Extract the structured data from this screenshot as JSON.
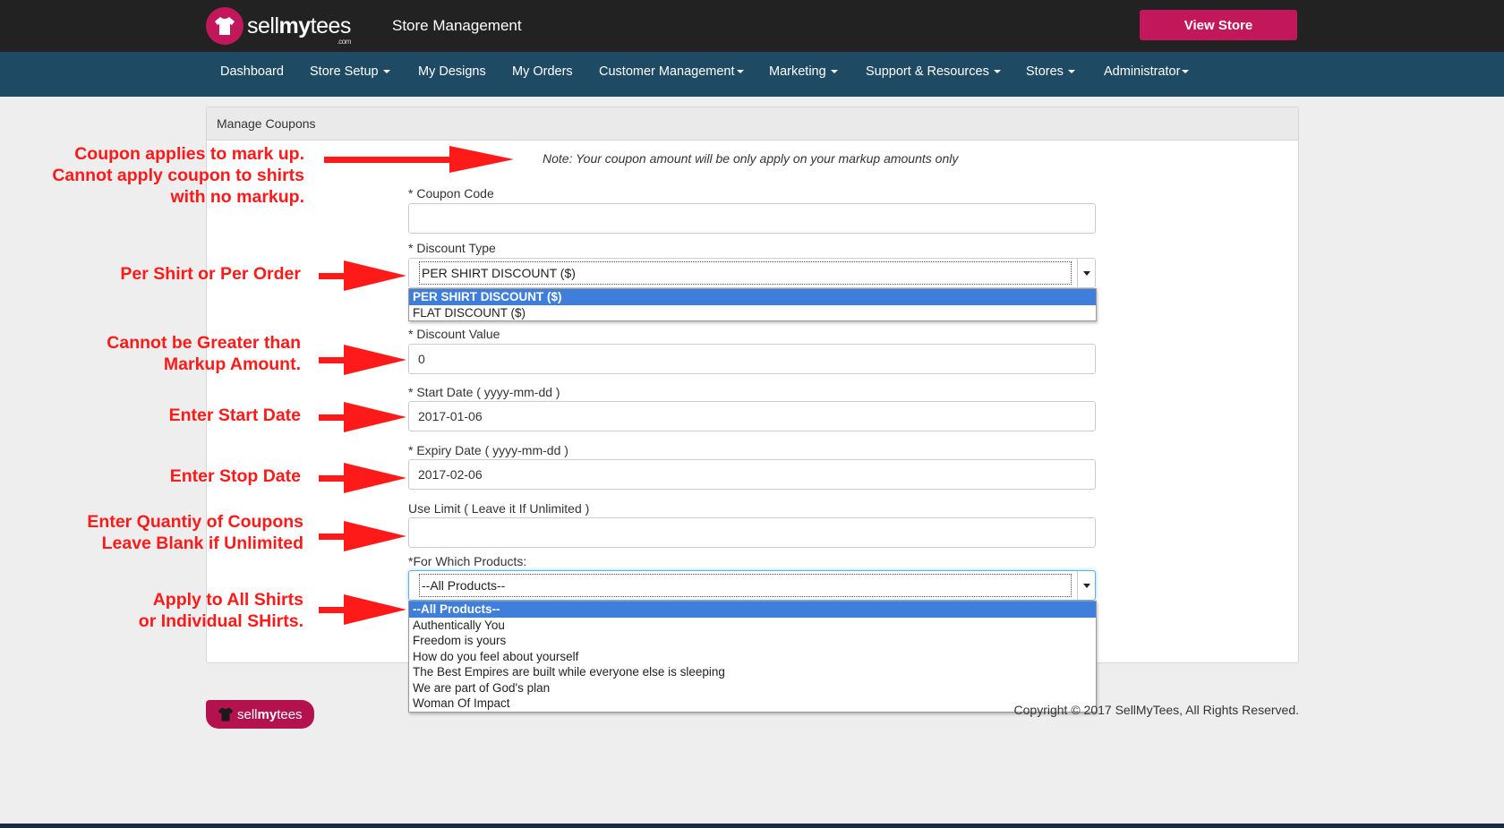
{
  "header": {
    "logo_sell": "sell",
    "logo_my": "my",
    "logo_tees": "tees",
    "logo_com": ".com",
    "title": "Store Management",
    "view_store_label": "View Store",
    "brand_color": "#c2185b"
  },
  "nav": {
    "items": [
      {
        "label": "Dashboard",
        "dropdown": false
      },
      {
        "label": "Store Setup",
        "dropdown": true
      },
      {
        "label": "My Designs",
        "dropdown": false
      },
      {
        "label": "My Orders",
        "dropdown": false
      },
      {
        "label": "Customer Management",
        "dropdown": true
      },
      {
        "label": "Marketing",
        "dropdown": true
      },
      {
        "label": "Support & Resources",
        "dropdown": true
      },
      {
        "label": "Stores",
        "dropdown": true
      },
      {
        "label": "Administrator",
        "dropdown": true
      }
    ],
    "color": "#1e4a63"
  },
  "panel": {
    "heading": "Manage Coupons",
    "note": "Note: Your coupon amount will be only apply on your markup amounts only"
  },
  "form": {
    "coupon_code": {
      "label": "* Coupon Code",
      "value": ""
    },
    "discount_type": {
      "label": "* Discount Type",
      "selected": "PER SHIRT DISCOUNT ($)",
      "options": [
        "PER SHIRT DISCOUNT ($)",
        "FLAT DISCOUNT ($)"
      ]
    },
    "discount_value": {
      "label": "* Discount Value",
      "value": "0"
    },
    "start_date": {
      "label": "* Start Date ( yyyy-mm-dd )",
      "value": "2017-01-06"
    },
    "expiry_date": {
      "label": "* Expiry Date ( yyyy-mm-dd )",
      "value": "2017-02-06"
    },
    "use_limit": {
      "label": "Use Limit ( Leave it If Unlimited )",
      "value": ""
    },
    "products": {
      "label": "*For Which Products:",
      "selected": "--All Products--",
      "options": [
        "--All Products--",
        "Authentically You",
        "Freedom is yours",
        "How do you feel about yourself",
        "The Best Empires are built while everyone else is sleeping",
        "We are part of God's plan",
        "Woman Of Impact"
      ]
    }
  },
  "annotations": {
    "markup_line1": "Coupon applies to mark up.",
    "markup_line2": "Cannot apply coupon to shirts",
    "markup_line3": "with no markup.",
    "type": "Per Shirt or Per Order",
    "value_line1": "Cannot be Greater than",
    "value_line2": "Markup Amount.",
    "start": "Enter Start Date",
    "stop": "Enter Stop Date",
    "limit_line1": "Enter Quantiy of Coupons",
    "limit_line2": "Leave Blank if Unlimited",
    "products_line1": "Apply to All Shirts",
    "products_line2": "or Individual SHirts.",
    "color": "#ff1a1a"
  },
  "footer": {
    "logo_sell": "sell",
    "logo_my": "my",
    "logo_tees": "tees",
    "copyright": "Copyright © 2017 SellMyTees, All Rights Reserved."
  }
}
